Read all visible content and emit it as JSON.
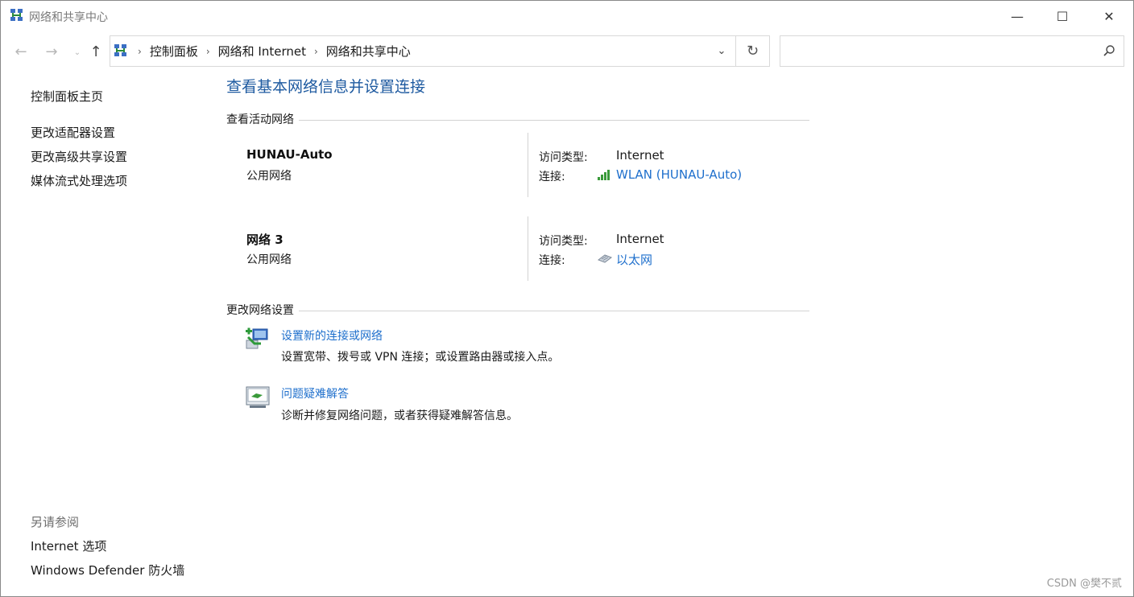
{
  "window": {
    "title": "网络和共享中心",
    "icon": "network-center-icon"
  },
  "window_controls": {
    "minimize": "—",
    "maximize": "☐",
    "close": "✕"
  },
  "navigation": {
    "back": "←",
    "forward": "→",
    "recent": "⌄",
    "up": "↑"
  },
  "address_bar": {
    "crumbs": [
      "控制面板",
      "网络和 Internet",
      "网络和共享中心"
    ],
    "separator": "›",
    "dropdown": "⌄",
    "refresh": "↻"
  },
  "search": {
    "value": "",
    "placeholder": ""
  },
  "sidebar": {
    "home": "控制面板主页",
    "items": [
      "更改适配器设置",
      "更改高级共享设置",
      "媒体流式处理选项"
    ],
    "see_also_title": "另请参阅",
    "see_also": [
      "Internet 选项",
      "Windows Defender 防火墙"
    ]
  },
  "main": {
    "title": "查看基本网络信息并设置连接",
    "active_section": "查看活动网络",
    "networks": [
      {
        "name": "HUNAU-Auto",
        "kind": "公用网络",
        "access_label": "访问类型:",
        "access_value": "Internet",
        "conn_label": "连接:",
        "conn_value": "WLAN (HUNAU-Auto)",
        "conn_icon": "wifi-signal-icon"
      },
      {
        "name": "网络 3",
        "kind": "公用网络",
        "access_label": "访问类型:",
        "access_value": "Internet",
        "conn_label": "连接:",
        "conn_value": "以太网",
        "conn_icon": "ethernet-icon"
      }
    ],
    "change_section": "更改网络设置",
    "tasks": [
      {
        "link": "设置新的连接或网络",
        "desc": "设置宽带、拨号或 VPN 连接；或设置路由器或接入点。",
        "icon": "new-connection-icon"
      },
      {
        "link": "问题疑难解答",
        "desc": "诊断并修复网络问题，或者获得疑难解答信息。",
        "icon": "troubleshoot-icon"
      }
    ]
  },
  "watermark": "CSDN @樊不贰",
  "colors": {
    "link": "#1e6fcc",
    "title": "#1e5aa0"
  }
}
